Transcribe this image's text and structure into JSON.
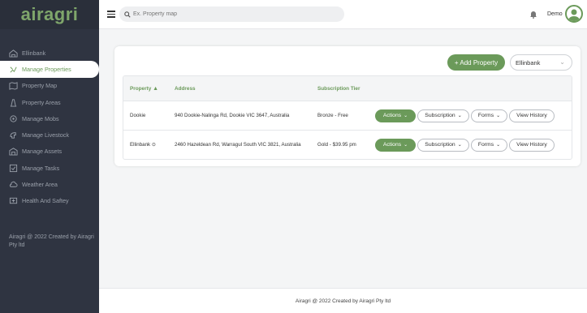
{
  "brand": {
    "logo": "airagri",
    "accent": "#6b9a5a",
    "sidebar_bg": "#2f3441"
  },
  "sidebar": {
    "items": [
      {
        "label": "Ellinbank",
        "icon": "farm-icon",
        "active": false
      },
      {
        "label": "Manage Properties",
        "icon": "properties-icon",
        "active": true
      },
      {
        "label": "Property Map",
        "icon": "map-icon",
        "active": false
      },
      {
        "label": "Property Areas",
        "icon": "areas-icon",
        "active": false
      },
      {
        "label": "Manage Mobs",
        "icon": "mobs-icon",
        "active": false
      },
      {
        "label": "Manage Livestock",
        "icon": "livestock-icon",
        "active": false
      },
      {
        "label": "Manage Assets",
        "icon": "assets-icon",
        "active": false
      },
      {
        "label": "Manage Tasks",
        "icon": "tasks-icon",
        "active": false
      },
      {
        "label": "Weather Area",
        "icon": "weather-icon",
        "active": false
      },
      {
        "label": "Health And Saftey",
        "icon": "health-icon",
        "active": false
      }
    ],
    "footer": "Airagri @ 2022 Created by Airagri Pty ltd"
  },
  "topbar": {
    "search_placeholder": "Ex. Property map",
    "user_name": "Demo"
  },
  "properties": {
    "add_label": "+ Add Property",
    "selected_farm": "Ellinbank",
    "columns": {
      "property": "Property",
      "address": "Address",
      "tier": "Subscription Tier"
    },
    "rows": [
      {
        "property": "Dookie",
        "address": "940 Dookie-Nalinga Rd, Dookie VIC 3647, Australia",
        "tier": "Bronze - Free",
        "verified": false
      },
      {
        "property": "Ellinbank",
        "address": "2460 Hazeldean Rd, Warragul South VIC 3821, Australia",
        "tier": "Gold - $39.95 pm",
        "verified": true
      }
    ],
    "actions": {
      "actions": "Actions",
      "subscription": "Subscription",
      "forms": "Forms",
      "history": "View History"
    }
  },
  "footer": "Airagri @ 2022 Created by Airagri Pty ltd"
}
